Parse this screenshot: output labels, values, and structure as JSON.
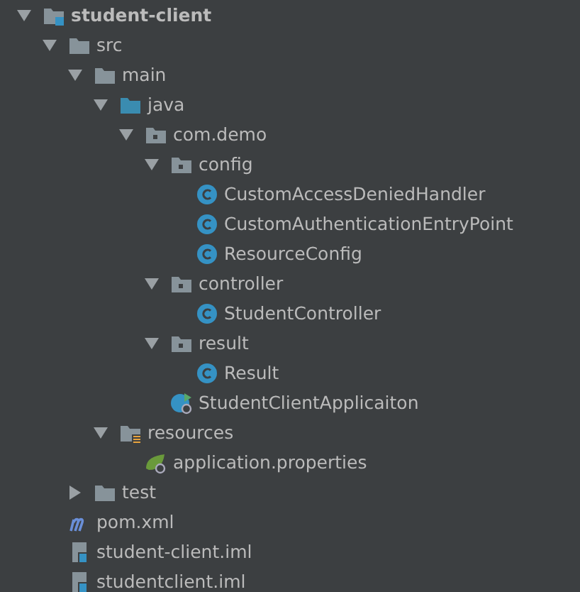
{
  "tree": [
    {
      "label": "student-client",
      "kind": "module",
      "expanded": true,
      "children": [
        {
          "label": "src",
          "kind": "folder",
          "expanded": true,
          "children": [
            {
              "label": "main",
              "kind": "folder",
              "expanded": true,
              "children": [
                {
                  "label": "java",
                  "kind": "source-folder",
                  "expanded": true,
                  "children": [
                    {
                      "label": "com.demo",
                      "kind": "package",
                      "expanded": true,
                      "children": [
                        {
                          "label": "config",
                          "kind": "package",
                          "expanded": true,
                          "children": [
                            {
                              "label": "CustomAccessDeniedHandler",
                              "kind": "class"
                            },
                            {
                              "label": "CustomAuthenticationEntryPoint",
                              "kind": "class"
                            },
                            {
                              "label": "ResourceConfig",
                              "kind": "class"
                            }
                          ]
                        },
                        {
                          "label": "controller",
                          "kind": "package",
                          "expanded": true,
                          "children": [
                            {
                              "label": "StudentController",
                              "kind": "class"
                            }
                          ]
                        },
                        {
                          "label": "result",
                          "kind": "package",
                          "expanded": true,
                          "children": [
                            {
                              "label": "Result",
                              "kind": "class"
                            }
                          ]
                        },
                        {
                          "label": "StudentClientApplicaiton",
                          "kind": "spring-app"
                        }
                      ]
                    }
                  ]
                },
                {
                  "label": "resources",
                  "kind": "resources",
                  "expanded": true,
                  "children": [
                    {
                      "label": "application.properties",
                      "kind": "properties"
                    }
                  ]
                }
              ]
            },
            {
              "label": "test",
              "kind": "folder",
              "expanded": false
            }
          ]
        },
        {
          "label": "pom.xml",
          "kind": "maven"
        },
        {
          "label": "student-client.iml",
          "kind": "iml"
        },
        {
          "label": "studentclient.iml",
          "kind": "iml"
        }
      ]
    }
  ]
}
